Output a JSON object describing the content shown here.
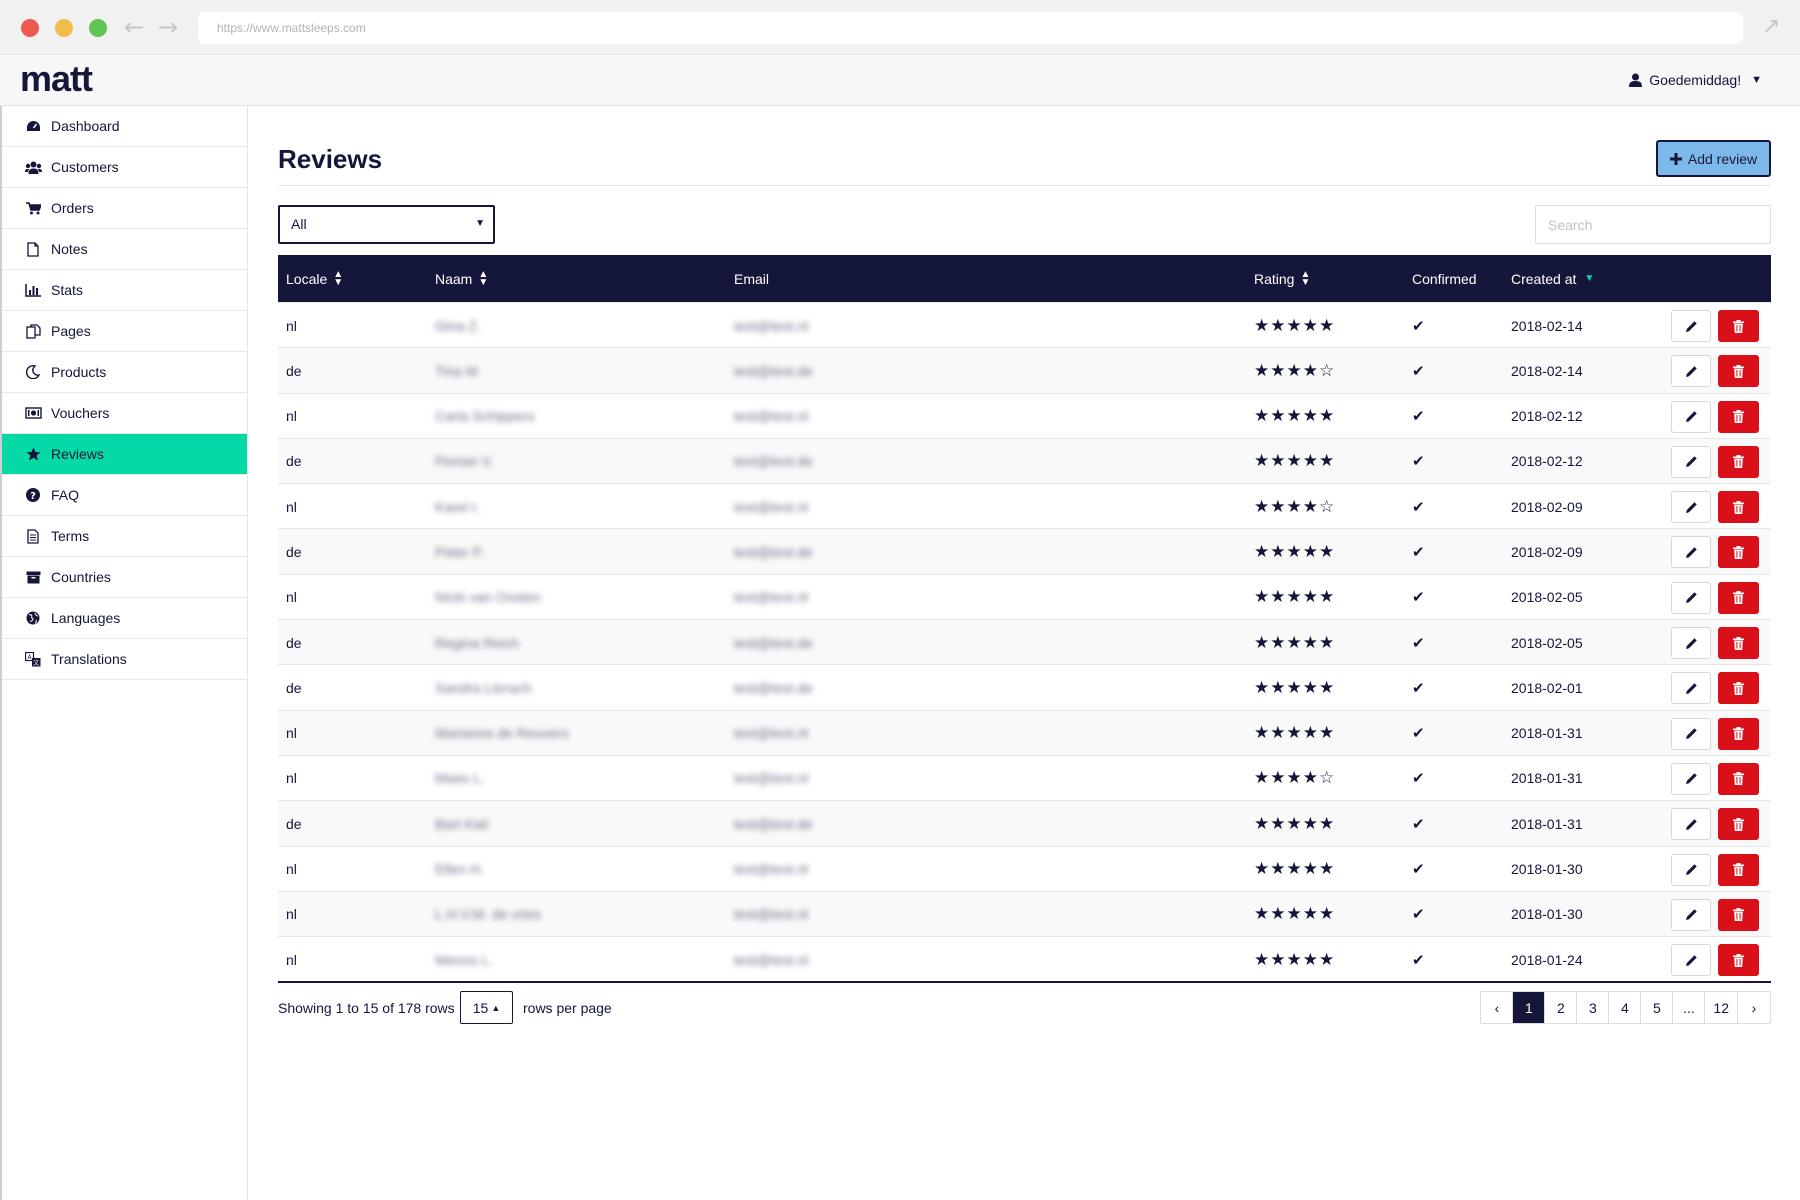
{
  "browser": {
    "url": "https://www.mattsleeps.com"
  },
  "header": {
    "logo": "matt",
    "greeting": "Goedemiddag!"
  },
  "sidebar": {
    "items": [
      {
        "label": "Dashboard",
        "icon": "dashboard-icon"
      },
      {
        "label": "Customers",
        "icon": "users-icon"
      },
      {
        "label": "Orders",
        "icon": "cart-icon"
      },
      {
        "label": "Notes",
        "icon": "file-icon"
      },
      {
        "label": "Stats",
        "icon": "bar-chart-icon"
      },
      {
        "label": "Pages",
        "icon": "copy-icon"
      },
      {
        "label": "Products",
        "icon": "moon-icon"
      },
      {
        "label": "Vouchers",
        "icon": "money-icon"
      },
      {
        "label": "Reviews",
        "icon": "star-icon",
        "active": true
      },
      {
        "label": "FAQ",
        "icon": "question-icon"
      },
      {
        "label": "Terms",
        "icon": "document-icon"
      },
      {
        "label": "Countries",
        "icon": "archive-icon"
      },
      {
        "label": "Languages",
        "icon": "globe-icon"
      },
      {
        "label": "Translations",
        "icon": "translate-icon"
      }
    ]
  },
  "main": {
    "title": "Reviews",
    "add_button": "Add review",
    "filter_value": "All",
    "search_placeholder": "Search"
  },
  "table": {
    "headers": {
      "locale": "Locale",
      "name": "Naam",
      "email": "Email",
      "rating": "Rating",
      "confirmed": "Confirmed",
      "created": "Created at"
    },
    "rows": [
      {
        "locale": "nl",
        "name": "Gina Z.",
        "email": "test@test.nl",
        "rating": 5,
        "confirmed": true,
        "created": "2018-02-14"
      },
      {
        "locale": "de",
        "name": "Tina M.",
        "email": "test@test.de",
        "rating": 4,
        "confirmed": true,
        "created": "2018-02-14"
      },
      {
        "locale": "nl",
        "name": "Carla Schippers",
        "email": "test@test.nl",
        "rating": 5,
        "confirmed": true,
        "created": "2018-02-12"
      },
      {
        "locale": "de",
        "name": "Florian V.",
        "email": "test@test.de",
        "rating": 5,
        "confirmed": true,
        "created": "2018-02-12"
      },
      {
        "locale": "nl",
        "name": "Karel I.",
        "email": "test@test.nl",
        "rating": 4,
        "confirmed": true,
        "created": "2018-02-09"
      },
      {
        "locale": "de",
        "name": "Peter P.",
        "email": "test@test.de",
        "rating": 5,
        "confirmed": true,
        "created": "2018-02-09"
      },
      {
        "locale": "nl",
        "name": "Nicki van Oosten",
        "email": "test@test.nl",
        "rating": 5,
        "confirmed": true,
        "created": "2018-02-05"
      },
      {
        "locale": "de",
        "name": "Regina Reich",
        "email": "test@test.de",
        "rating": 5,
        "confirmed": true,
        "created": "2018-02-05"
      },
      {
        "locale": "de",
        "name": "Sandra Lörrach",
        "email": "test@test.de",
        "rating": 5,
        "confirmed": true,
        "created": "2018-02-01"
      },
      {
        "locale": "nl",
        "name": "Marianne de Reuvers",
        "email": "test@test.nl",
        "rating": 5,
        "confirmed": true,
        "created": "2018-01-31"
      },
      {
        "locale": "nl",
        "name": "Maes L.",
        "email": "test@test.nl",
        "rating": 4,
        "confirmed": true,
        "created": "2018-01-31"
      },
      {
        "locale": "de",
        "name": "Bart Kail",
        "email": "test@test.de",
        "rating": 5,
        "confirmed": true,
        "created": "2018-01-31"
      },
      {
        "locale": "nl",
        "name": "Ellen H.",
        "email": "test@test.nl",
        "rating": 5,
        "confirmed": true,
        "created": "2018-01-30"
      },
      {
        "locale": "nl",
        "name": "L.H.V.M. de vries",
        "email": "test@test.nl",
        "rating": 5,
        "confirmed": true,
        "created": "2018-01-30"
      },
      {
        "locale": "nl",
        "name": "Menno L.",
        "email": "test@test.nl",
        "rating": 5,
        "confirmed": true,
        "created": "2018-01-24"
      }
    ]
  },
  "footer": {
    "showing": "Showing 1 to 15 of 178 rows",
    "per_page": "15",
    "rows_per_page": "rows per page",
    "pages": [
      "‹",
      "1",
      "2",
      "3",
      "4",
      "5",
      "...",
      "12",
      "›"
    ],
    "active_page": "1"
  },
  "colors": {
    "navy": "#14163a",
    "accent": "#05d9a6",
    "add_button": "#7cb9ea",
    "danger": "#d9101a"
  }
}
